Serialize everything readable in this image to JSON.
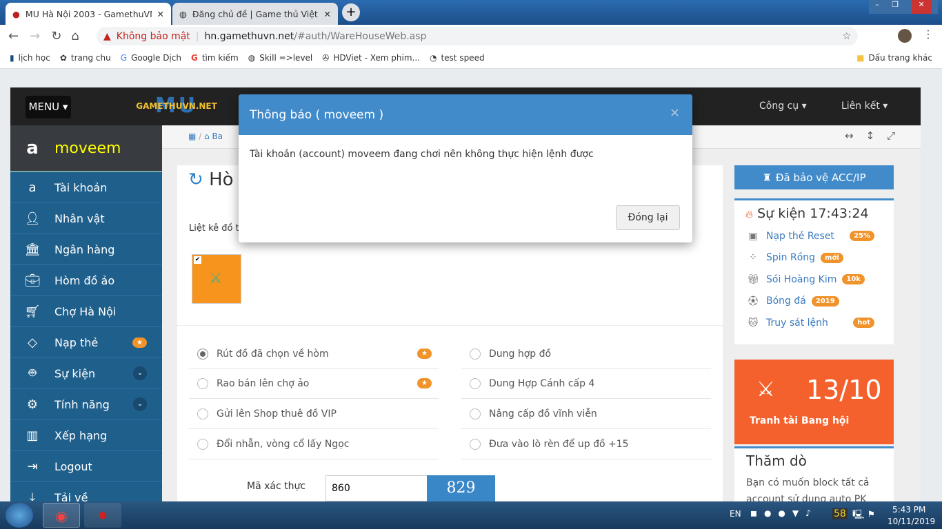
{
  "browser": {
    "tabs": [
      {
        "title": "MU Hà Nội 2003 - GamethuVN.net"
      },
      {
        "title": "Đăng chủ đề | Game thủ Việt Nam"
      }
    ],
    "security": "Không bảo mật",
    "url_host": "hn.gamethuvn.net",
    "url_path": "/#auth/WareHouseWeb.asp",
    "bookmarks": [
      "lịch học",
      "trang chu",
      "Google Dịch",
      "tìm kiếm",
      "Skill =>level",
      "HDViet - Xem phim...",
      "test speed"
    ],
    "other_bookmarks": "Dấu trang khác"
  },
  "header": {
    "menu": "MENU",
    "logo": "GAMETHUVN.NET",
    "nav": [
      "Công cụ",
      "Liên kết"
    ]
  },
  "user": {
    "name": "moveem"
  },
  "sidebar": [
    {
      "label": "Tài khoản",
      "icon": "amazon-icon"
    },
    {
      "label": "Nhân vật",
      "icon": "user-icon"
    },
    {
      "label": "Ngân hàng",
      "icon": "bank-icon"
    },
    {
      "label": "Hòm đồ ảo",
      "icon": "briefcase-icon"
    },
    {
      "label": "Chợ Hà Nội",
      "icon": "cart-icon"
    },
    {
      "label": "Nạp thẻ",
      "icon": "diamond-icon"
    },
    {
      "label": "Sự kiện",
      "icon": "android-icon"
    },
    {
      "label": "Tính năng",
      "icon": "gears-icon"
    },
    {
      "label": "Xếp hạng",
      "icon": "bar-chart-icon"
    },
    {
      "label": "Logout",
      "icon": "sign-out-icon"
    },
    {
      "label": "Tải về",
      "icon": "download-icon"
    }
  ],
  "breadcrumb": [
    "Ba"
  ],
  "main": {
    "title": "Hò",
    "list_label": "Liệt kê đồ t",
    "options_left": [
      "Rút đồ đã chọn về hòm",
      "Rao bán lên chợ ảo",
      "Gửi lên Shop thuê đồ VIP",
      "Đổi nhẫn, vòng cổ lấy Ngọc"
    ],
    "options_right": [
      "Dung hợp đồ",
      "Dung Hợp Cánh cấp 4",
      "Nâng cấp đồ vĩnh viễn",
      "Đưa vào lò rèn để up đồ +15"
    ],
    "captcha_label": "Mã xác thực",
    "captcha_value": "860",
    "captcha_code": "829"
  },
  "right": {
    "protect": "Đã bảo vệ ACC/IP",
    "events_title": "Sự kiện 17:43:24",
    "events": [
      {
        "label": "Nạp thẻ Reset",
        "badge": "25%"
      },
      {
        "label": "Spin Rồng",
        "badge": "mới"
      },
      {
        "label": "Sói Hoàng Kim",
        "badge": "10k"
      },
      {
        "label": "Bóng đá",
        "badge": "2019"
      },
      {
        "label": "Truy sát lệnh",
        "badge": "hot"
      }
    ],
    "guild_score": "13/10",
    "guild_label": "Tranh tài Bang hội",
    "poll_title": "Thăm dò",
    "poll_text": "Bạn có muốn block tất cả account sử dụng auto PK"
  },
  "modal": {
    "title": "Thông báo ( moveem )",
    "message": "Tài khoản (account) moveem đang chơi nên không thực hiện lệnh được",
    "close_btn": "Đóng lại"
  },
  "taskbar": {
    "lang": "EN",
    "tray_num": "58",
    "time": "5:43 PM",
    "date": "10/11/2019"
  },
  "colors": {
    "accent": "#428bca",
    "sidebar": "#1f5f8b",
    "badge": "#f0932b",
    "guild": "#f5612c"
  }
}
